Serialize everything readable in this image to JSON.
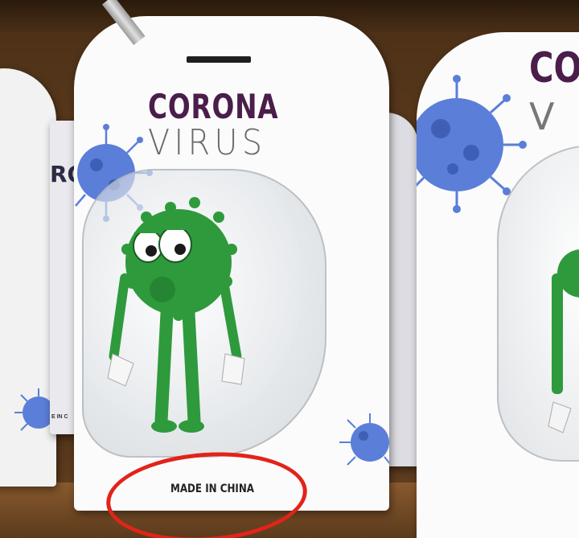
{
  "scene": {
    "title_line1": "CORONA",
    "title_line2": "VIRUS",
    "origin_label": "MADE IN CHINA",
    "right_title_partial": "CO",
    "right_subtitle_partial": "V",
    "back_title_partial": "RO",
    "back_origin_partial": "E IN C"
  },
  "colors": {
    "title": "#4a1d4a",
    "subtitle": "#6a6a6a",
    "virus_blue": "#5b7ed8",
    "toy_green": "#2e9a3c",
    "highlight_ring": "#e2231a",
    "shelf_wood": "#5b3a1c"
  },
  "icons": [
    "virus-graphic-icon",
    "hanging-hook",
    "highlight-circle"
  ]
}
